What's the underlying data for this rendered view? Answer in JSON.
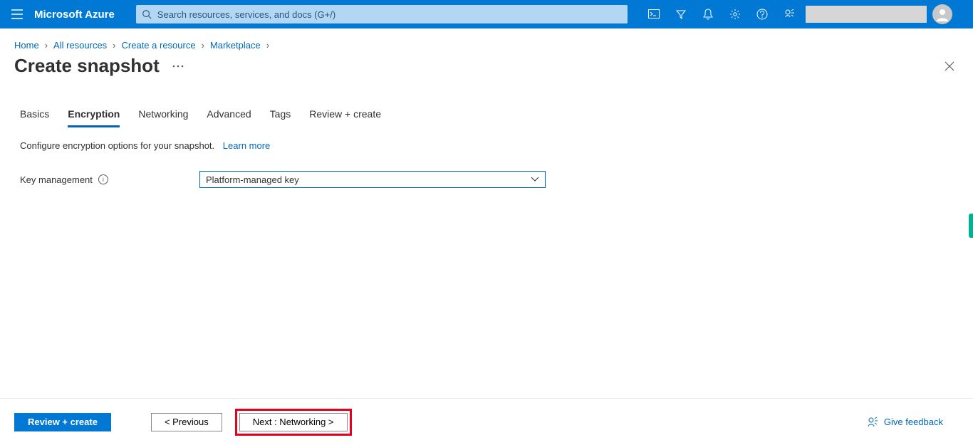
{
  "header": {
    "brand": "Microsoft Azure",
    "search_placeholder": "Search resources, services, and docs (G+/)"
  },
  "breadcrumb": {
    "items": [
      "Home",
      "All resources",
      "Create a resource",
      "Marketplace"
    ]
  },
  "page": {
    "title": "Create snapshot"
  },
  "tabs": {
    "items": [
      "Basics",
      "Encryption",
      "Networking",
      "Advanced",
      "Tags",
      "Review + create"
    ],
    "active_index": 1
  },
  "description": {
    "text": "Configure encryption options for your snapshot.",
    "learn_more": "Learn more"
  },
  "form": {
    "key_management_label": "Key management",
    "key_management_value": "Platform-managed key"
  },
  "footer": {
    "review_create": "Review + create",
    "previous": "< Previous",
    "next": "Next : Networking >",
    "feedback": "Give feedback"
  }
}
